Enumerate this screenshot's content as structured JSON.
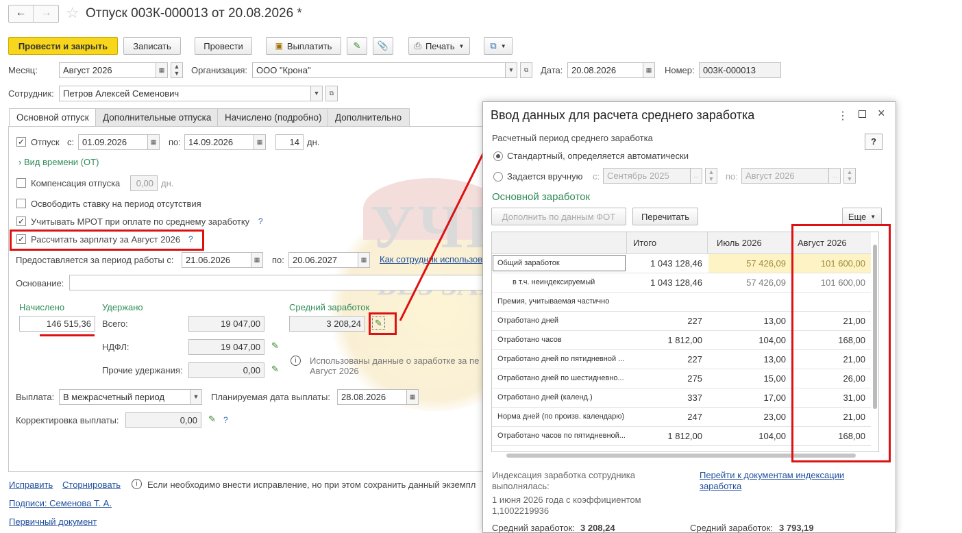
{
  "window": {
    "title": "Отпуск 003К-000013 от 20.08.2026 *"
  },
  "toolbar": {
    "post_close": "Провести и закрыть",
    "save": "Записать",
    "post": "Провести",
    "pay": "Выплатить",
    "print": "Печать"
  },
  "header": {
    "month_label": "Месяц:",
    "month_value": "Август 2026",
    "org_label": "Организация:",
    "org_value": "ООО \"Крона\"",
    "date_label": "Дата:",
    "date_value": "20.08.2026",
    "number_label": "Номер:",
    "number_value": "003К-000013",
    "employee_label": "Сотрудник:",
    "employee_value": "Петров Алексей Семенович"
  },
  "tabs": [
    "Основной отпуск",
    "Дополнительные отпуска",
    "Начислено (подробно)",
    "Дополнительно"
  ],
  "main": {
    "vacation_label": "Отпуск",
    "from_label": "с:",
    "from_value": "01.09.2026",
    "to_label": "по:",
    "to_value": "14.09.2026",
    "days_value": "14",
    "days_unit": "дн.",
    "time_type": "Вид времени (ОТ)",
    "compensation_label": "Компенсация отпуска",
    "compensation_value": "0,00",
    "compensation_unit": "дн.",
    "free_rate": "Освободить ставку на период отсутствия",
    "mrot": "Учитывать МРОТ при оплате по среднему заработку",
    "calc_salary": "Рассчитать зарплату за Август 2026",
    "period_label": "Предоставляется за период работы с:",
    "period_from": "21.06.2026",
    "period_to_label": "по:",
    "period_to": "20.06.2027",
    "employee_link": "Как сотрудник использов",
    "basis_label": "Основание:",
    "accrued_label": "Начислено",
    "accrued_value": "146 515,36",
    "withheld_label": "Удержано",
    "total_label": "Всего:",
    "total_value": "19 047,00",
    "ndfl_label": "НДФЛ:",
    "ndfl_value": "19 047,00",
    "other_label": "Прочие удержания:",
    "other_value": "0,00",
    "avg_label": "Средний заработок",
    "avg_value": "3 208,24",
    "info_text1": "Использованы данные о заработке за пе",
    "info_text2": "Август 2026",
    "payment_label": "Выплата:",
    "payment_value": "В межрасчетный период",
    "planned_label": "Планируемая дата выплаты:",
    "planned_value": "28.08.2026",
    "correction_label": "Корректировка выплаты:",
    "correction_value": "0,00"
  },
  "footer": {
    "fix": "Исправить",
    "reverse": "Сторнировать",
    "info": "Если необходимо внести исправление, но при этом сохранить данный экземпл",
    "signatures": "Подписи: Семенова Т. А.",
    "primary": "Первичный документ"
  },
  "modal": {
    "title": "Ввод данных для расчета среднего заработка",
    "help": "?",
    "period_caption": "Расчетный период среднего заработка",
    "standard": "Стандартный, определяется автоматически",
    "manual": "Задается вручную",
    "m_from_label": "с:",
    "m_from": "Сентябрь 2025",
    "m_to_label": "по:",
    "m_to": "Август 2026",
    "section": "Основной заработок",
    "fill_fot": "Дополнить по данным ФОТ",
    "reread": "Перечитать",
    "more": "Еще",
    "columns": [
      "Итого",
      "Июль 2026",
      "Август 2026"
    ],
    "rows": [
      {
        "name": "Общий заработок",
        "total": "1 043 128,46",
        "jul": "57 426,09",
        "aug": "101 600,00"
      },
      {
        "name": "в т.ч. неиндексируемый",
        "total": "1 043 128,46",
        "jul": "57 426,09",
        "aug": "101 600,00"
      },
      {
        "name": "Премия, учитываемая частично",
        "total": "",
        "jul": "",
        "aug": ""
      },
      {
        "name": "Отработано дней",
        "total": "227",
        "jul": "13,00",
        "aug": "21,00"
      },
      {
        "name": "Отработано часов",
        "total": "1 812,00",
        "jul": "104,00",
        "aug": "168,00"
      },
      {
        "name": "Отработано дней по пятидневной ...",
        "total": "227",
        "jul": "13,00",
        "aug": "21,00"
      },
      {
        "name": "Отработано дней по шестидневно...",
        "total": "275",
        "jul": "15,00",
        "aug": "26,00"
      },
      {
        "name": "Отработано дней (календ.)",
        "total": "337",
        "jul": "17,00",
        "aug": "31,00"
      },
      {
        "name": "Норма дней (по произв. календарю)",
        "total": "247",
        "jul": "23,00",
        "aug": "21,00"
      },
      {
        "name": "Отработано часов по пятидневной...",
        "total": "1 812,00",
        "jul": "104,00",
        "aug": "168,00"
      }
    ],
    "index_text1": "Индексация заработка сотрудника",
    "index_text2": "выполнялась:",
    "index_text3": "1 июня 2026 года с коэффициентом",
    "index_text4": "1,1002219936",
    "index_link1": "Перейти к документам индексации",
    "index_link2": "заработка",
    "avg1_label": "Средний заработок:",
    "avg1_value": "3 208,24",
    "avg2_label": "Средний заработок:",
    "avg2_value": "3 793,19"
  },
  "watermark": {
    "line1": "УЧЕТ",
    "line2": "БЕЗ ЗАБОТ"
  }
}
